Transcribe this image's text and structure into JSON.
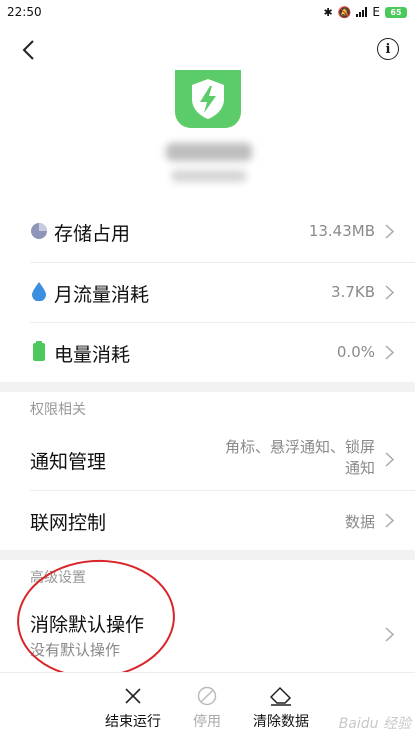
{
  "status_bar": {
    "time": "22:50",
    "network": "E",
    "battery": "65"
  },
  "storage": {
    "label": "存储占用",
    "value": "13.43MB"
  },
  "traffic": {
    "label": "月流量消耗",
    "value": "3.7KB"
  },
  "power": {
    "label": "电量消耗",
    "value": "0.0%"
  },
  "permissions": {
    "header": "权限相关",
    "notification": {
      "label": "通知管理",
      "value_line1": "角标、悬浮通知、锁屏",
      "value_line2": "通知"
    },
    "network": {
      "label": "联网控制",
      "value": "数据"
    }
  },
  "advanced": {
    "header": "高级设置",
    "clear_defaults": {
      "label": "消除默认操作",
      "sub": "没有默认操作"
    }
  },
  "bottom_bar": {
    "force_stop": "结束运行",
    "disable": "停用",
    "clear_data": "清除数据"
  },
  "watermark": "Baidu 经验",
  "colors": {
    "accent_green": "#5ccc6a",
    "storage_icon": "#8f95b8",
    "traffic_icon": "#3a8fe0",
    "power_icon": "#4cc95c",
    "annotation_red": "#d9242a"
  }
}
